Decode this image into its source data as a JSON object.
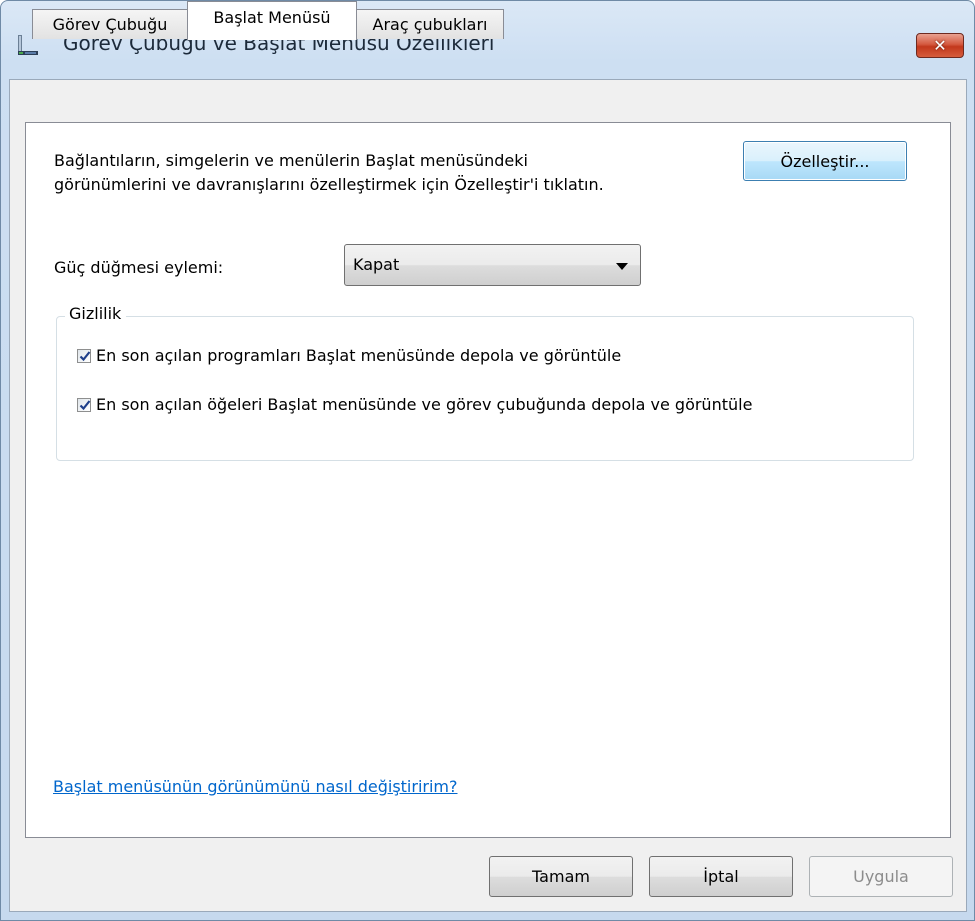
{
  "window": {
    "title": "Görev Çubuğu ve Başlat Menüsü Özellikleri",
    "close_symbol": "✕"
  },
  "tabs": [
    {
      "label": "Görev Çubuğu",
      "active": false
    },
    {
      "label": "Başlat Menüsü",
      "active": true
    },
    {
      "label": "Araç çubukları",
      "active": false
    }
  ],
  "start_menu": {
    "description_line1": "Bağlantıların, simgelerin ve menülerin Başlat menüsündeki",
    "description_line2": "görünümlerini ve davranışlarını özelleştirmek için Özelleştir'i tıklatın.",
    "customize_button": "Özelleştir...",
    "power_label": "Güç düğmesi eylemi:",
    "power_value": "Kapat",
    "privacy_title": "Gizlilik",
    "checkboxes": [
      {
        "label": "En son açılan programları Başlat menüsünde depola ve görüntüle",
        "checked": true
      },
      {
        "label": "En son açılan öğeleri Başlat menüsünde ve görev çubuğunda depola ve görüntüle",
        "checked": true
      }
    ],
    "help_link": "Başlat menüsünün görünümünü nasıl değiştiririm?"
  },
  "footer": {
    "ok": "Tamam",
    "cancel": "İptal",
    "apply": "Uygula"
  },
  "icons": {
    "app": "taskbar-icon",
    "close": "close-icon",
    "check": "checkmark-icon",
    "dropdown": "chevron-down-icon"
  },
  "colors": {
    "title_gradient_top": "#dbe8f6",
    "close_red": "#c2381c",
    "focus_blue": "#3c7fb1",
    "link": "#0066cc",
    "check": "#1e3f8a"
  }
}
